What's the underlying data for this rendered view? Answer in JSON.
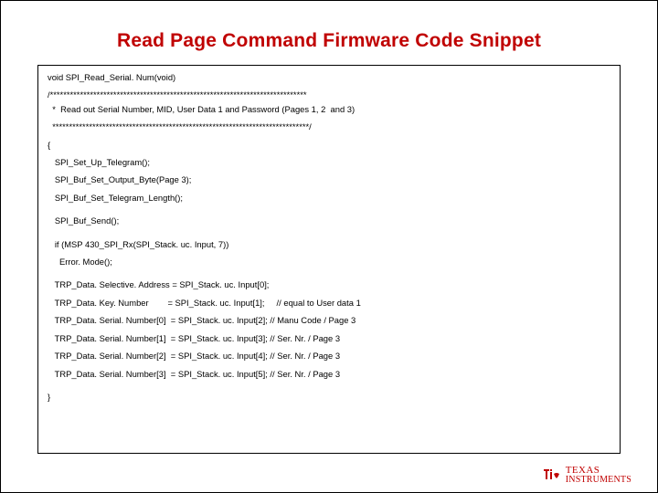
{
  "title": "Read Page Command Firmware Code Snippet",
  "code": {
    "l0": "void SPI_Read_Serial. Num(void)",
    "l1": "/*****************************************************************************",
    "l2": "  *  Read out Serial Number, MID, User Data 1 and Password (Pages 1, 2  and 3)",
    "l3": "  *****************************************************************************/",
    "l4": "{",
    "l5": "   SPI_Set_Up_Telegram();",
    "l6": "   SPI_Buf_Set_Output_Byte(Page 3);",
    "l7": "   SPI_Buf_Set_Telegram_Length();",
    "l8": "   SPI_Buf_Send();",
    "l9": "   if (MSP 430_SPI_Rx(SPI_Stack. uc. Input, 7))",
    "l10": "     Error. Mode();",
    "l11": "   TRP_Data. Selective. Address = SPI_Stack. uc. Input[0];",
    "l12": "   TRP_Data. Key. Number        = SPI_Stack. uc. Input[1];     // equal to User data 1",
    "l13": "   TRP_Data. Serial. Number[0]  = SPI_Stack. uc. Input[2]; // Manu Code / Page 3",
    "l14": "   TRP_Data. Serial. Number[1]  = SPI_Stack. uc. Input[3]; // Ser. Nr. / Page 3",
    "l15": "   TRP_Data. Serial. Number[2]  = SPI_Stack. uc. Input[4]; // Ser. Nr. / Page 3",
    "l16": "   TRP_Data. Serial. Number[3]  = SPI_Stack. uc. Input[5]; // Ser. Nr. / Page 3",
    "l17": "}"
  },
  "logo": {
    "line1": "TEXAS",
    "line2": "INSTRUMENTS"
  }
}
